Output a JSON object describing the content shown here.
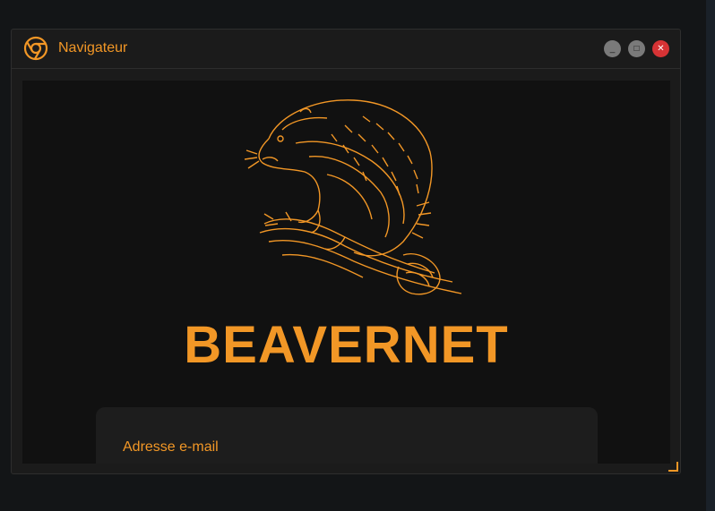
{
  "window": {
    "title": "Navigateur",
    "app_icon": "browser-icon",
    "controls": {
      "minimize_icon": "minimize-icon",
      "minimize_glyph": "_",
      "maximize_icon": "maximize-icon",
      "maximize_glyph": "□",
      "close_icon": "close-icon",
      "close_glyph": "✕"
    }
  },
  "page": {
    "logo_icon": "beaver-illustration",
    "brand_name": "BEAVERNET",
    "login": {
      "email_label": "Adresse e-mail"
    }
  },
  "colors": {
    "accent": "#f29726",
    "window_bg": "#1b1b1b",
    "content_bg": "#111111",
    "card_bg": "#1d1d1d",
    "close": "#d63335",
    "control_gray": "#7a7a7a"
  }
}
